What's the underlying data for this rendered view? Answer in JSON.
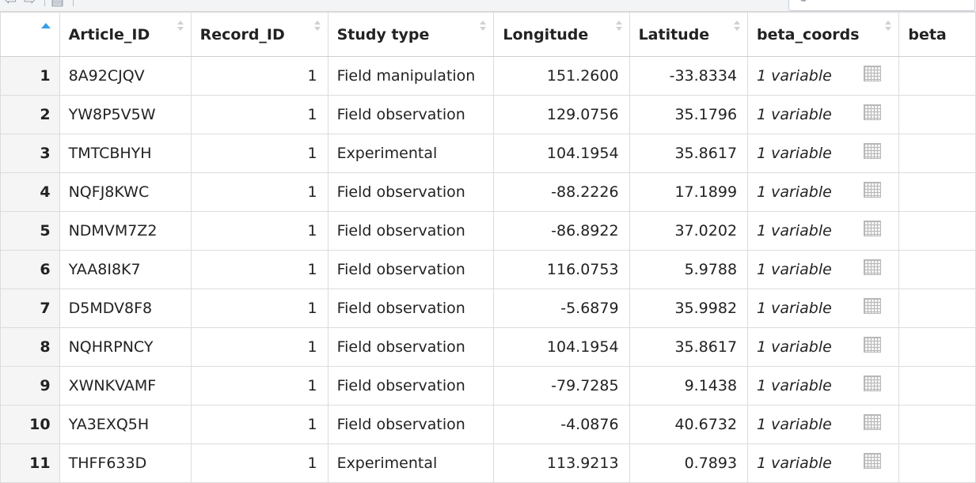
{
  "toolbar": {
    "back_icon": "back-arrow-icon",
    "forward_icon": "forward-arrow-icon",
    "filter_icon": "filter-icon",
    "search_icon": "search-icon"
  },
  "table": {
    "columns": [
      "",
      "Article_ID",
      "Record_ID",
      "Study type",
      "Longitude",
      "Latitude",
      "beta_coords",
      "beta"
    ],
    "rows": [
      {
        "index": "1",
        "article_id": "8A92CJQV",
        "record_id": "1",
        "study_type": "Field manipulation",
        "longitude": "151.2600",
        "latitude": "-33.8334",
        "beta_coords": "1 variable"
      },
      {
        "index": "2",
        "article_id": "YW8P5V5W",
        "record_id": "1",
        "study_type": "Field observation",
        "longitude": "129.0756",
        "latitude": "35.1796",
        "beta_coords": "1 variable"
      },
      {
        "index": "3",
        "article_id": "TMTCBHYH",
        "record_id": "1",
        "study_type": "Experimental",
        "longitude": "104.1954",
        "latitude": "35.8617",
        "beta_coords": "1 variable"
      },
      {
        "index": "4",
        "article_id": "NQFJ8KWC",
        "record_id": "1",
        "study_type": "Field observation",
        "longitude": "-88.2226",
        "latitude": "17.1899",
        "beta_coords": "1 variable"
      },
      {
        "index": "5",
        "article_id": "NDMVM7Z2",
        "record_id": "1",
        "study_type": "Field observation",
        "longitude": "-86.8922",
        "latitude": "37.0202",
        "beta_coords": "1 variable"
      },
      {
        "index": "6",
        "article_id": "YAA8I8K7",
        "record_id": "1",
        "study_type": "Field observation",
        "longitude": "116.0753",
        "latitude": "5.9788",
        "beta_coords": "1 variable"
      },
      {
        "index": "7",
        "article_id": "D5MDV8F8",
        "record_id": "1",
        "study_type": "Field observation",
        "longitude": "-5.6879",
        "latitude": "35.9982",
        "beta_coords": "1 variable"
      },
      {
        "index": "8",
        "article_id": "NQHRPNCY",
        "record_id": "1",
        "study_type": "Field observation",
        "longitude": "104.1954",
        "latitude": "35.8617",
        "beta_coords": "1 variable"
      },
      {
        "index": "9",
        "article_id": "XWNKVAMF",
        "record_id": "1",
        "study_type": "Field observation",
        "longitude": "-79.7285",
        "latitude": "9.1438",
        "beta_coords": "1 variable"
      },
      {
        "index": "10",
        "article_id": "YA3EXQ5H",
        "record_id": "1",
        "study_type": "Field observation",
        "longitude": "-4.0876",
        "latitude": "40.6732",
        "beta_coords": "1 variable"
      },
      {
        "index": "11",
        "article_id": "THFF633D",
        "record_id": "1",
        "study_type": "Experimental",
        "longitude": "113.9213",
        "latitude": "0.7893",
        "beta_coords": "1 variable"
      }
    ],
    "cell_icon": "dataframe-grid-icon",
    "sort_active_color": "#3a9ee8",
    "border_color": "#dcdcdc"
  }
}
